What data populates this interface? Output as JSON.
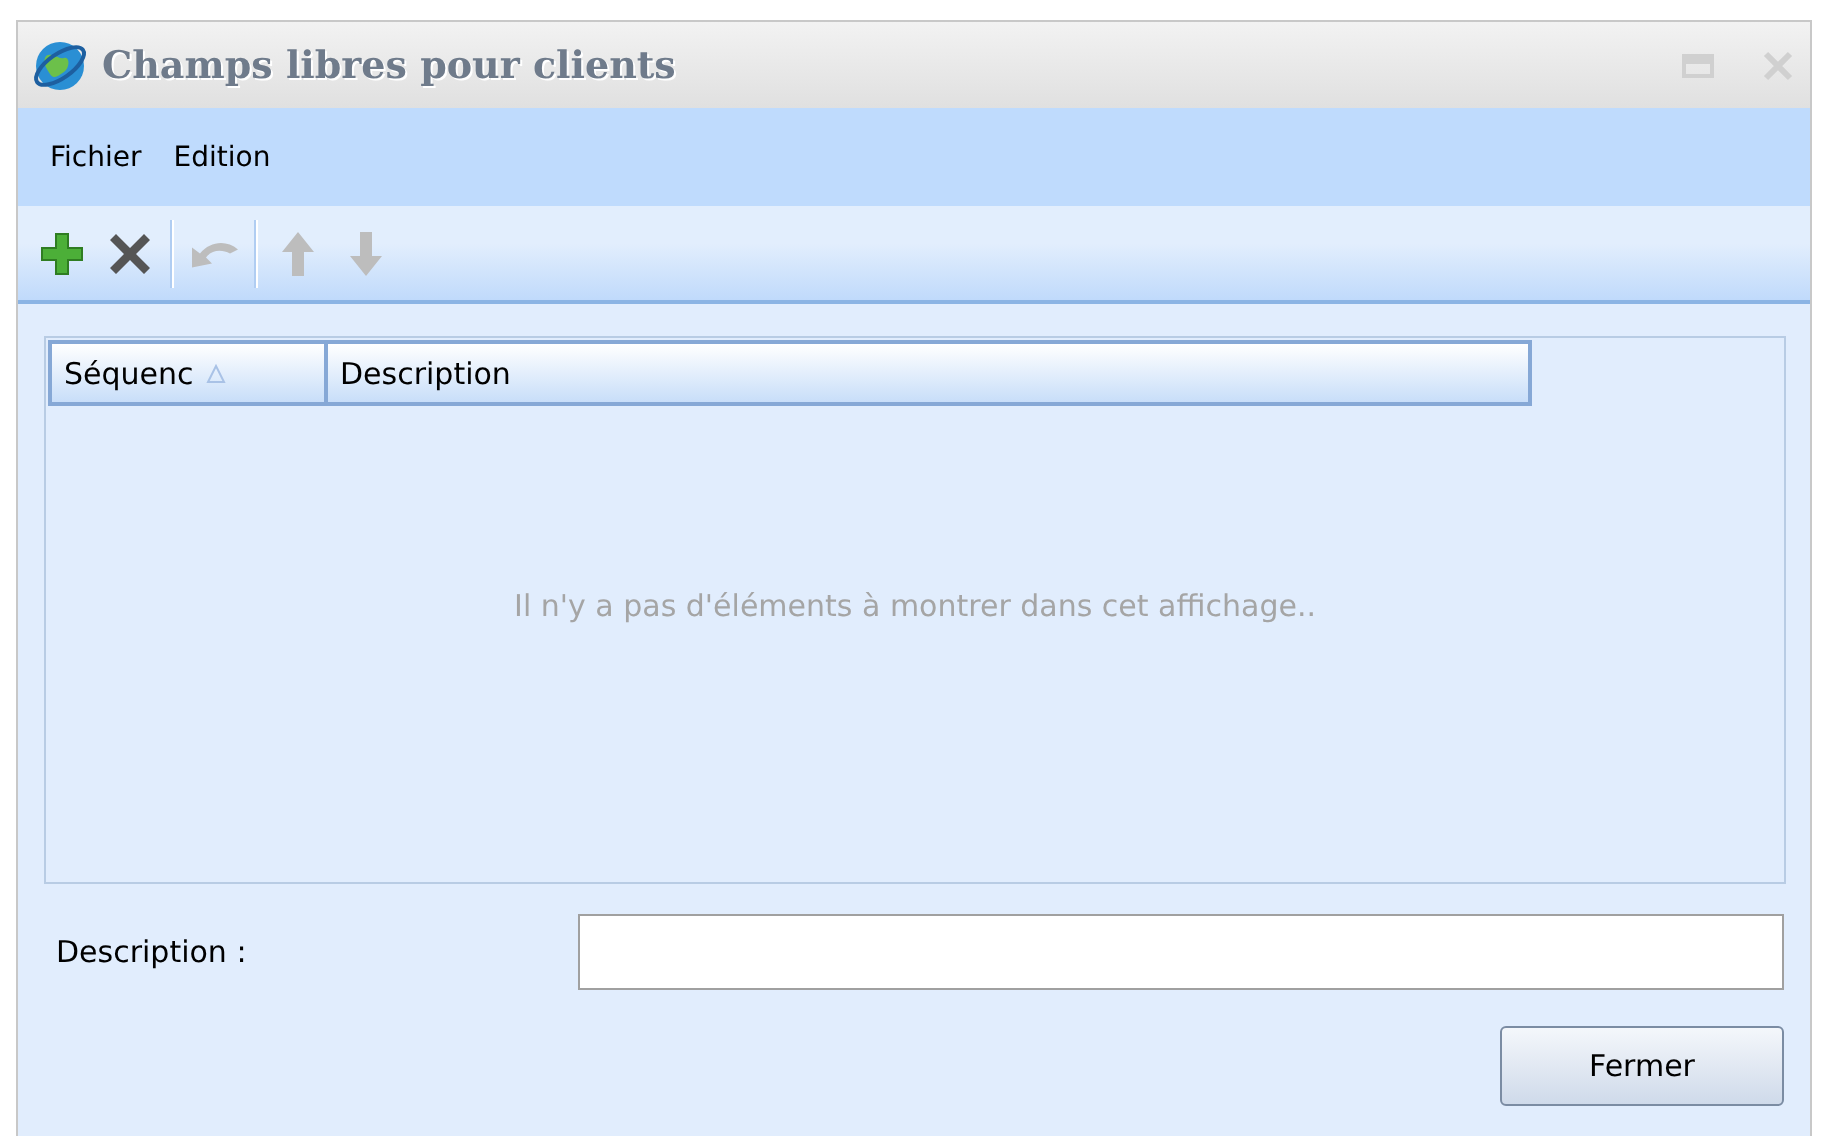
{
  "window": {
    "title": "Champs libres pour clients"
  },
  "menu": [
    "Fichier",
    "Edition"
  ],
  "toolbar": [
    {
      "kind": "add",
      "disabled": false
    },
    {
      "kind": "delete",
      "disabled": false
    },
    {
      "kind": "separator"
    },
    {
      "kind": "undo",
      "disabled": true
    },
    {
      "kind": "separator"
    },
    {
      "kind": "up",
      "disabled": true
    },
    {
      "kind": "down",
      "disabled": true
    }
  ],
  "table": {
    "columns": [
      {
        "label": "Séquenc",
        "sorted": true
      },
      {
        "label": "Description",
        "sorted": false
      }
    ],
    "empty_message": "Il n'y a pas d'éléments à montrer dans cet affichage.."
  },
  "form": {
    "label": "Description :"
  },
  "buttons": [
    "Fermer"
  ]
}
